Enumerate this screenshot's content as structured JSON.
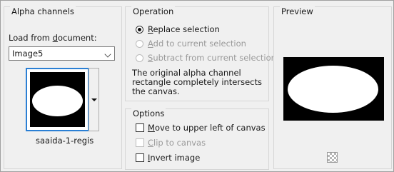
{
  "alpha": {
    "title": "Alpha channels",
    "load_label_prefix": "Load from ",
    "load_label_accel": "d",
    "load_label_suffix": "ocument:",
    "document_value": "Image5",
    "channel_name": "saaida-1-regis"
  },
  "operation": {
    "title": "Operation",
    "options": [
      {
        "accel": "R",
        "rest": "eplace selection",
        "selected": true,
        "enabled": true
      },
      {
        "accel": "A",
        "rest": "dd to current selection",
        "selected": false,
        "enabled": false
      },
      {
        "accel": "S",
        "rest": "ubtract from current selection",
        "selected": false,
        "enabled": false
      }
    ],
    "description": "The original alpha channel rectangle completely intersects the canvas."
  },
  "options": {
    "title": "Options",
    "items": [
      {
        "accel": "M",
        "rest": "ove to upper left of canvas",
        "checked": false,
        "enabled": true
      },
      {
        "accel": "C",
        "rest": "lip to canvas",
        "checked": false,
        "enabled": false
      },
      {
        "accel": "I",
        "rest": "nvert image",
        "checked": false,
        "enabled": true
      }
    ]
  },
  "preview": {
    "title": "Preview",
    "background_icon": "checkerboard-icon"
  },
  "colors": {
    "dialog_bg": "#f0f0f0",
    "selection_border": "#2a7fd4",
    "disabled_text": "#9a9a9a"
  }
}
